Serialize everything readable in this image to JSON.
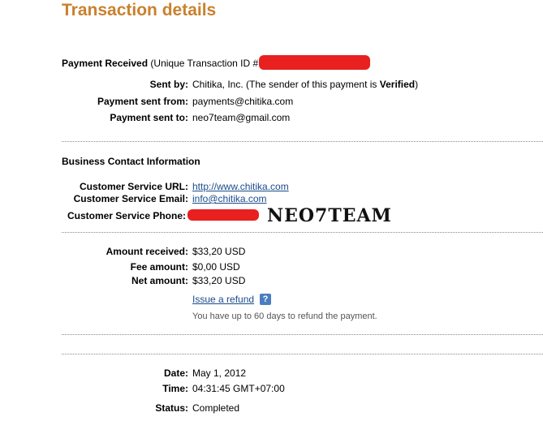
{
  "page_title": "Transaction details",
  "payment": {
    "received_label": "Payment Received",
    "txn_id_prefix": "(Unique Transaction ID #",
    "sent_by_label": "Sent by:",
    "sent_by_value": "Chitika, Inc. (The sender of this payment is",
    "sent_by_status": "Verified",
    "sent_by_close": ")",
    "sent_from_label": "Payment sent from:",
    "sent_from_value": "payments@chitika.com",
    "sent_to_label": "Payment sent to:",
    "sent_to_value": "neo7team@gmail.com"
  },
  "business": {
    "heading": "Business Contact Information",
    "url_label": "Customer Service URL:",
    "url_value": "http://www.chitika.com",
    "email_label": "Customer Service Email:",
    "email_value": "info@chitika.com",
    "phone_label": "Customer Service Phone:",
    "watermark": "NEO7TEAM"
  },
  "amounts": {
    "received_label": "Amount received:",
    "received_value": "$33,20 USD",
    "fee_label": "Fee amount:",
    "fee_value": "$0,00 USD",
    "net_label": "Net amount:",
    "net_value": "$33,20 USD",
    "refund_link": "Issue a refund",
    "help_glyph": "?",
    "refund_note": "You have up to 60 days to refund the payment."
  },
  "details": {
    "date_label": "Date:",
    "date_value": "May 1, 2012",
    "time_label": "Time:",
    "time_value": "04:31:45 GMT+07:00",
    "status_label": "Status:",
    "status_value": "Completed"
  },
  "colors": {
    "title": "#c9812e",
    "link": "#1a4b8c",
    "redaction": "#e8201f"
  }
}
